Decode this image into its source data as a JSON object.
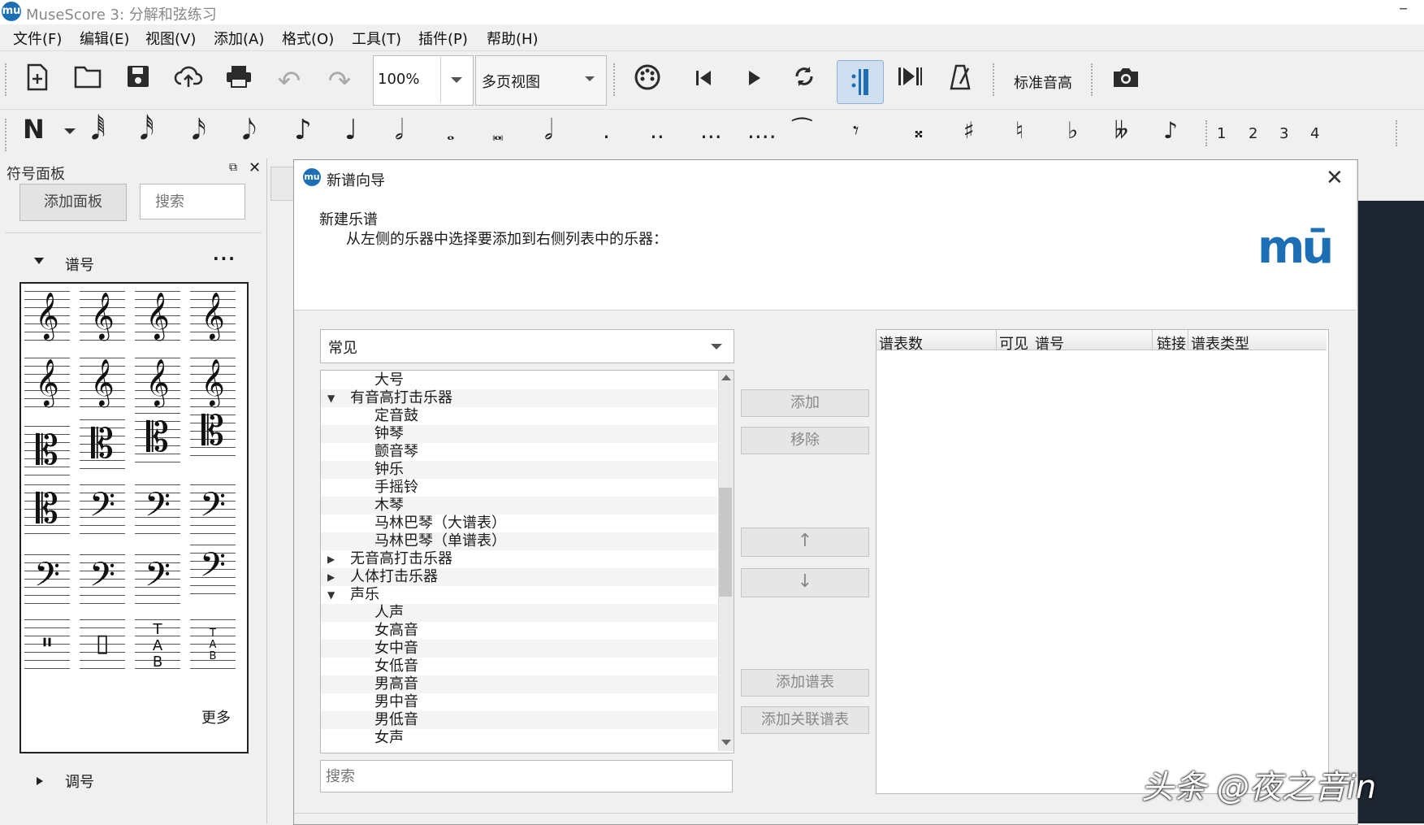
{
  "window": {
    "title": "MuseScore 3: 分解和弦练习",
    "logo": "mu"
  },
  "menu": [
    "文件(F)",
    "编辑(E)",
    "视图(V)",
    "添加(A)",
    "格式(O)",
    "工具(T)",
    "插件(P)",
    "帮助(H)"
  ],
  "toolbar": {
    "zoom": "100%",
    "view_mode": "多页视图",
    "concert_pitch": "标准音高",
    "voices": [
      "1",
      "2",
      "3",
      "4"
    ]
  },
  "palette": {
    "title": "符号面板",
    "add_button": "添加面板",
    "search_placeholder": "搜索",
    "section": "谱号",
    "more": "更多",
    "section2": "调号"
  },
  "dialog": {
    "title": "新谱向导",
    "heading": "新建乐谱",
    "subheading": "从左侧的乐器中选择要添加到右侧列表中的乐器：",
    "logo_text": "mū",
    "category": "常见",
    "instruments": [
      {
        "label": "大号",
        "indent": 2
      },
      {
        "label": "有音高打击乐器",
        "indent": 1,
        "expanded": true
      },
      {
        "label": "定音鼓",
        "indent": 2
      },
      {
        "label": "钟琴",
        "indent": 2
      },
      {
        "label": "颤音琴",
        "indent": 2
      },
      {
        "label": "钟乐",
        "indent": 2
      },
      {
        "label": "手摇铃",
        "indent": 2
      },
      {
        "label": "木琴",
        "indent": 2
      },
      {
        "label": "马林巴琴（大谱表）",
        "indent": 2
      },
      {
        "label": "马林巴琴（单谱表）",
        "indent": 2
      },
      {
        "label": "无音高打击乐器",
        "indent": 1,
        "expanded": false
      },
      {
        "label": "人体打击乐器",
        "indent": 1,
        "expanded": false
      },
      {
        "label": "声乐",
        "indent": 1,
        "expanded": true
      },
      {
        "label": "人声",
        "indent": 2
      },
      {
        "label": "女高音",
        "indent": 2
      },
      {
        "label": "女中音",
        "indent": 2
      },
      {
        "label": "女低音",
        "indent": 2
      },
      {
        "label": "男高音",
        "indent": 2
      },
      {
        "label": "男中音",
        "indent": 2
      },
      {
        "label": "男低音",
        "indent": 2
      },
      {
        "label": "女声",
        "indent": 2
      }
    ],
    "search_placeholder": "搜索",
    "buttons": {
      "add": "添加",
      "remove": "移除",
      "up": "↑",
      "down": "↓",
      "add_staff": "添加谱表",
      "add_linked_staff": "添加关联谱表"
    },
    "table_headers": [
      "谱表数",
      "可见",
      "谱号",
      "链接",
      "谱表类型"
    ]
  },
  "watermark": "头条 @夜之音in"
}
